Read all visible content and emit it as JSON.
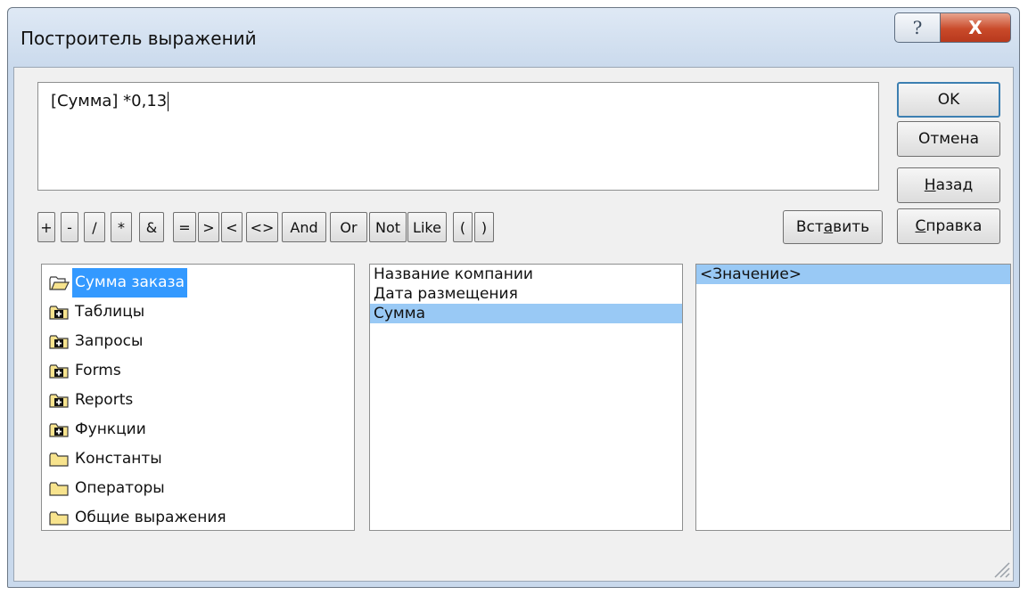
{
  "window": {
    "title": "Построитель выражений",
    "help_glyph": "?",
    "close_glyph": "X"
  },
  "expression": {
    "value": "[Сумма] *0,13"
  },
  "buttons": {
    "ok": "OK",
    "cancel": "Отмена",
    "back_pre": "",
    "back_ul": "Н",
    "back_post": "азад",
    "help_pre": "",
    "help_ul": "С",
    "help_post": "правка",
    "paste_pre": "Вст",
    "paste_ul": "а",
    "paste_post": "вить"
  },
  "operators": [
    "+",
    "-",
    "/",
    "*",
    "&",
    "=",
    ">",
    "<",
    "<>",
    "And",
    "Or",
    "Not",
    "Like",
    "(",
    ")"
  ],
  "tree": {
    "items": [
      {
        "label": "Сумма заказа",
        "icon": "open-folder-icon",
        "selected": true
      },
      {
        "label": "Таблицы",
        "icon": "expand-folder-icon"
      },
      {
        "label": "Запросы",
        "icon": "expand-folder-icon"
      },
      {
        "label": "Forms",
        "icon": "expand-folder-icon"
      },
      {
        "label": "Reports",
        "icon": "expand-folder-icon"
      },
      {
        "label": "Функции",
        "icon": "expand-folder-icon"
      },
      {
        "label": "Константы",
        "icon": "folder-icon"
      },
      {
        "label": "Операторы",
        "icon": "folder-icon"
      },
      {
        "label": "Общие выражения",
        "icon": "folder-icon"
      }
    ]
  },
  "fields": {
    "items": [
      {
        "label": "Название компании"
      },
      {
        "label": "Дата размещения"
      },
      {
        "label": "Сумма",
        "selected": true
      }
    ]
  },
  "values": {
    "items": [
      {
        "label": "<Значение>",
        "selected": true
      }
    ]
  },
  "colors": {
    "selection": "#3399ff",
    "list_selection": "#99c9f5",
    "close_button": "#c94a2a"
  }
}
